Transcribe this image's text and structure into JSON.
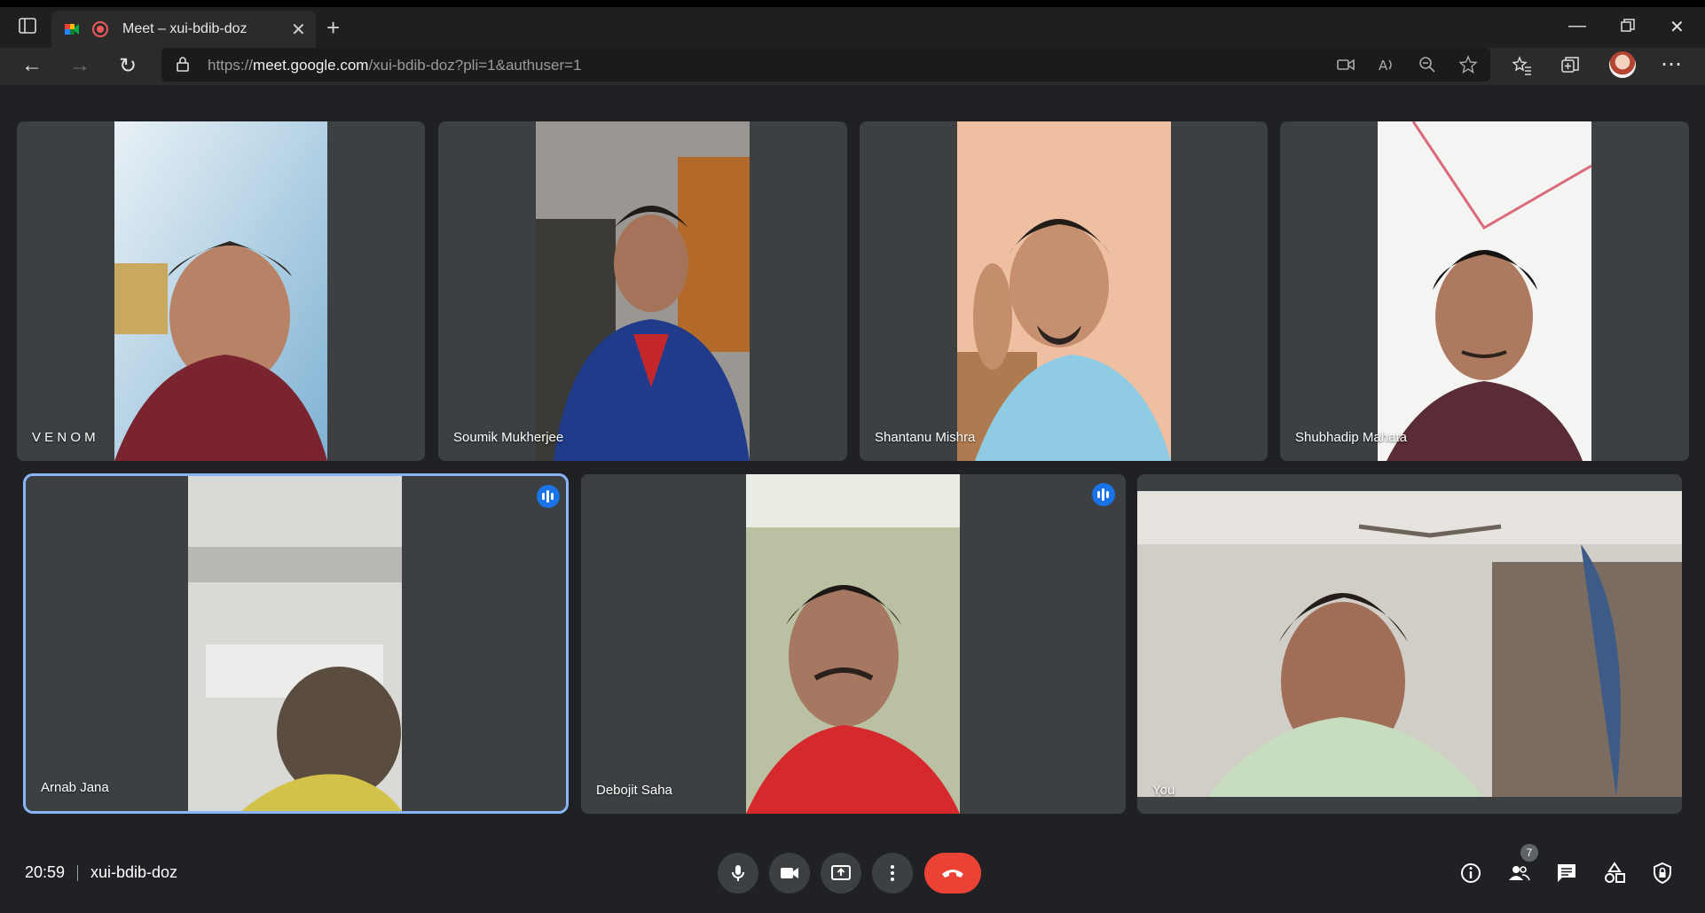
{
  "browser": {
    "tab_title": "Meet – xui-bdib-doz",
    "url_prefix": "https://",
    "url_host": "meet.google.com",
    "url_path": "/xui-bdib-doz?pli=1&authuser=1"
  },
  "participants": [
    {
      "name": "V E N O M"
    },
    {
      "name": "Soumik Mukherjee"
    },
    {
      "name": "Shantanu Mishra"
    },
    {
      "name": "Shubhadip Mahata"
    },
    {
      "name": "Arnab Jana"
    },
    {
      "name": "Debojit Saha"
    },
    {
      "name": "You"
    }
  ],
  "meeting": {
    "time": "20:59",
    "code": "xui-bdib-doz",
    "people_count": "7"
  },
  "colors": {
    "accent": "#8ab4f8",
    "speaking": "#1a73e8",
    "end_call": "#ea4335",
    "tile_bg": "#3c4043",
    "page_bg": "#202124"
  }
}
